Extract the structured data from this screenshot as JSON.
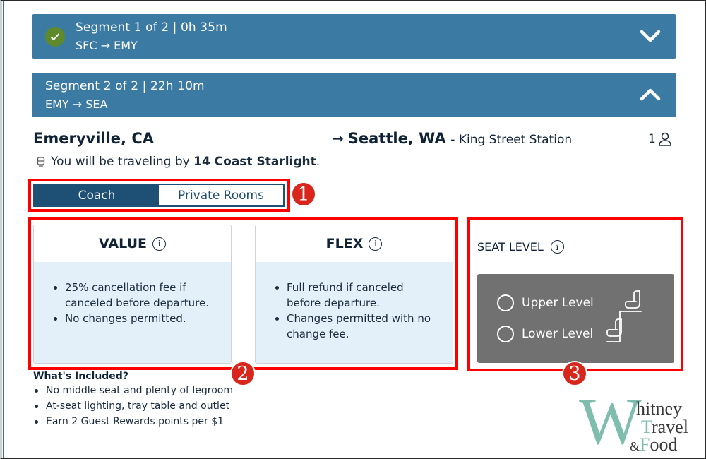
{
  "segments": [
    {
      "title": "Segment 1 of 2 | 0h 35m",
      "route": "SFC → EMY",
      "status": "completed",
      "chevron": "chevron-down-icon"
    },
    {
      "title": "Segment 2 of 2 | 22h 10m",
      "route": "EMY → SEA",
      "status": "expanded",
      "chevron": "chevron-up-icon"
    }
  ],
  "trip": {
    "origin": "Emeryville, CA",
    "arrow": "→",
    "destination_city": "Seattle, WA",
    "destination_station": "- King Street Station",
    "passengers": "1",
    "traveling_prefix": "You will be traveling by ",
    "train_name": "14 Coast Starlight",
    "traveling_suffix": "."
  },
  "class_toggle": {
    "options": [
      "Coach",
      "Private Rooms"
    ],
    "selected": "Coach"
  },
  "fares": [
    {
      "name": "VALUE",
      "bullets": [
        "25% cancellation fee if canceled before departure.",
        "No changes permitted."
      ]
    },
    {
      "name": "FLEX",
      "bullets": [
        "Full refund if canceled before departure.",
        "Changes permitted with no change fee."
      ]
    }
  ],
  "seat_level": {
    "title": "SEAT LEVEL",
    "options": [
      "Upper Level",
      "Lower Level"
    ],
    "selected": null
  },
  "included": {
    "title": "What's Included?",
    "items": [
      "No middle seat and plenty of legroom",
      "At-seat lighting, tray table and outlet",
      "Earn 2 Guest Rewards points per $1"
    ]
  },
  "annotations": [
    "1",
    "2",
    "3"
  ],
  "watermark": {
    "big_letter": "W",
    "line1_cap": "",
    "line1_rest": "hitney",
    "line2_cap": "T",
    "line2_rest": "ravel",
    "line3_amp": "&",
    "line3_cap": "F",
    "line3_rest": "ood"
  },
  "colors": {
    "segment_header": "#3b7ba3",
    "toggle_active": "#1e4f75",
    "check_green": "#5e8a2c",
    "fare_body": "#e3f0f9",
    "seat_panel": "#717171",
    "annotation_red": "#ff0000",
    "badge_red": "#d9261c",
    "logo_teal": "#7fbdaf"
  }
}
